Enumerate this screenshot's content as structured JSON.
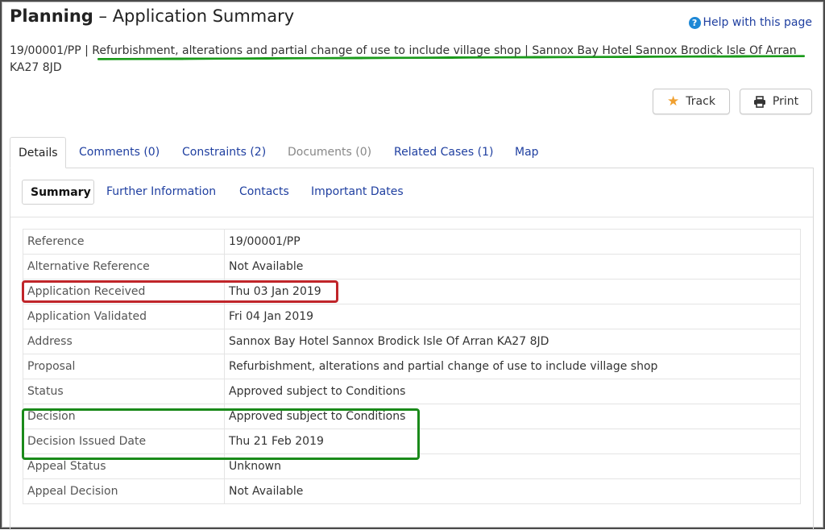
{
  "header": {
    "title_bold": "Planning",
    "title_rest": " – Application Summary",
    "help_icon": "?",
    "help_label": "Help with this page"
  },
  "subline": {
    "reference": "19/00001/PP",
    "separator": " | ",
    "description": "Refurbishment, alterations and partial change of use to include village shop | Sannox Bay Hotel Sannox Brodick Isle Of Arran KA27 8JD"
  },
  "actions": {
    "track_label": "Track",
    "print_label": "Print",
    "track_icon": "star-icon",
    "print_icon": "printer-icon"
  },
  "tabs": [
    {
      "label": "Details"
    },
    {
      "label": "Comments (0)"
    },
    {
      "label": "Constraints (2)"
    },
    {
      "label": "Documents (0)"
    },
    {
      "label": "Related Cases (1)"
    },
    {
      "label": "Map"
    }
  ],
  "subtabs": [
    {
      "label": "Summary"
    },
    {
      "label": "Further Information"
    },
    {
      "label": "Contacts"
    },
    {
      "label": "Important Dates"
    }
  ],
  "details": [
    {
      "key": "Reference",
      "value": "19/00001/PP"
    },
    {
      "key": "Alternative Reference",
      "value": "Not Available"
    },
    {
      "key": "Application Received",
      "value": "Thu 03 Jan 2019"
    },
    {
      "key": "Application Validated",
      "value": "Fri 04 Jan 2019"
    },
    {
      "key": "Address",
      "value": "Sannox Bay Hotel Sannox Brodick Isle Of Arran KA27 8JD"
    },
    {
      "key": "Proposal",
      "value": "Refurbishment, alterations and partial change of use to include village shop"
    },
    {
      "key": "Status",
      "value": "Approved subject to Conditions"
    },
    {
      "key": "Decision",
      "value": "Approved subject to Conditions"
    },
    {
      "key": "Decision Issued Date",
      "value": "Thu 21 Feb 2019"
    },
    {
      "key": "Appeal Status",
      "value": "Unknown"
    },
    {
      "key": "Appeal Decision",
      "value": "Not Available"
    }
  ],
  "colors": {
    "link": "#1f3fa0",
    "highlight_red": "#c0252a",
    "highlight_green": "#1a8a1a"
  }
}
